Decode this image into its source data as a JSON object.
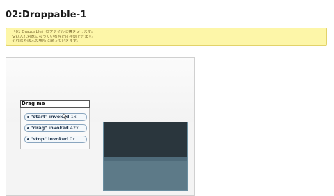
{
  "page": {
    "title": "02:Droppable-1"
  },
  "notice": {
    "lines": [
      "「01 Draggable」のファイルに書き足します。",
      "受け入れ対象になっている枠だけ移動できます。",
      "それ以外は元の場所に戻っていきます。"
    ]
  },
  "demo": {
    "drag_label": "Drag me",
    "events": [
      {
        "name": "\"start\" invoked",
        "count": "1x"
      },
      {
        "name": "\"drag\" invoked",
        "count": "42x"
      },
      {
        "name": "\"stop\" invoked",
        "count": "0x"
      }
    ]
  },
  "colors": {
    "notice_bg": "#fdf6a8",
    "droppable_dark": "#2a363d",
    "droppable_light": "#5d7a88"
  },
  "icons": [
    "bullet-icon",
    "cursor-icon"
  ]
}
